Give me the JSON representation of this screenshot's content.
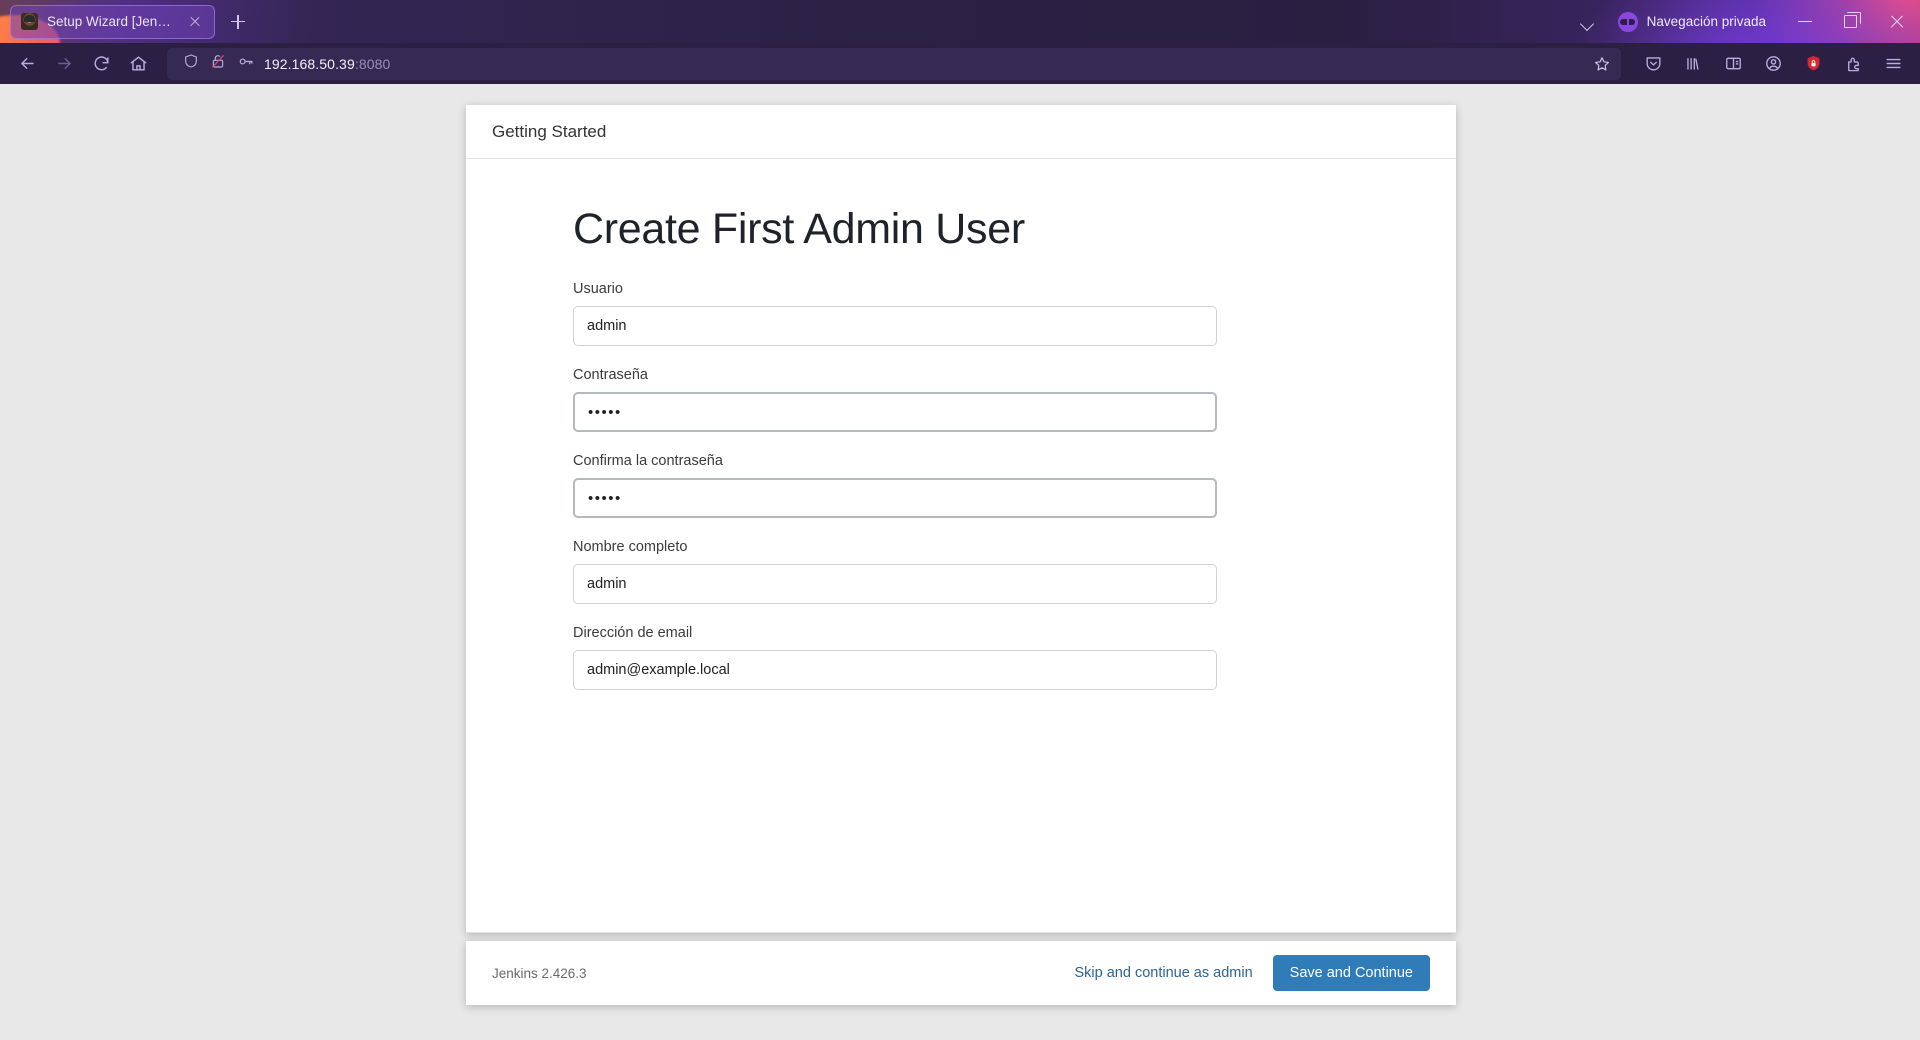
{
  "browser": {
    "tab": {
      "title": "Setup Wizard [Jenkins]",
      "favicon": "jenkins-butler-icon",
      "close_label": "×"
    },
    "new_tab_label": "+",
    "private_browsing_label": "Navegación privada",
    "private_icon": "mask-icon",
    "window_controls": {
      "minimize": "–",
      "maximize": "□",
      "close": "×"
    },
    "nav": {
      "back": "back-arrow-icon",
      "forward": "forward-arrow-icon",
      "reload": "reload-icon",
      "home": "home-icon"
    },
    "url": {
      "host": "192.168.50.39",
      "port": ":8080",
      "shield_icon": "shield-icon",
      "lock_icon": "broken-lock-icon",
      "key_icon": "key-icon",
      "bookmark_icon": "star-icon"
    },
    "toolbar_icons": [
      "pocket-save-icon",
      "library-icon",
      "reader-sidebar-icon",
      "account-icon",
      "tracking-protection-shield-icon",
      "extensions-icon",
      "app-menu-icon"
    ]
  },
  "wizard": {
    "header_title": "Getting Started",
    "page_title": "Create First Admin User",
    "fields": [
      {
        "label": "Usuario",
        "value": "admin",
        "type": "text",
        "focused": false
      },
      {
        "label": "Contraseña",
        "value": "•••••",
        "type": "password",
        "focused": true
      },
      {
        "label": "Confirma la contraseña",
        "value": "•••••",
        "type": "password",
        "focused": true
      },
      {
        "label": "Nombre completo",
        "value": "admin",
        "type": "text",
        "focused": false
      },
      {
        "label": "Dirección de email",
        "value": "admin@example.local",
        "type": "email",
        "focused": false
      }
    ],
    "footer": {
      "version": "Jenkins 2.426.3",
      "skip_label": "Skip and continue as admin",
      "submit_label": "Save and Continue"
    }
  },
  "colors": {
    "primary_button": "#2f7cb8",
    "link": "#2a6496",
    "chrome_bg": "#2b2044",
    "page_bg": "#e8e8e8"
  }
}
